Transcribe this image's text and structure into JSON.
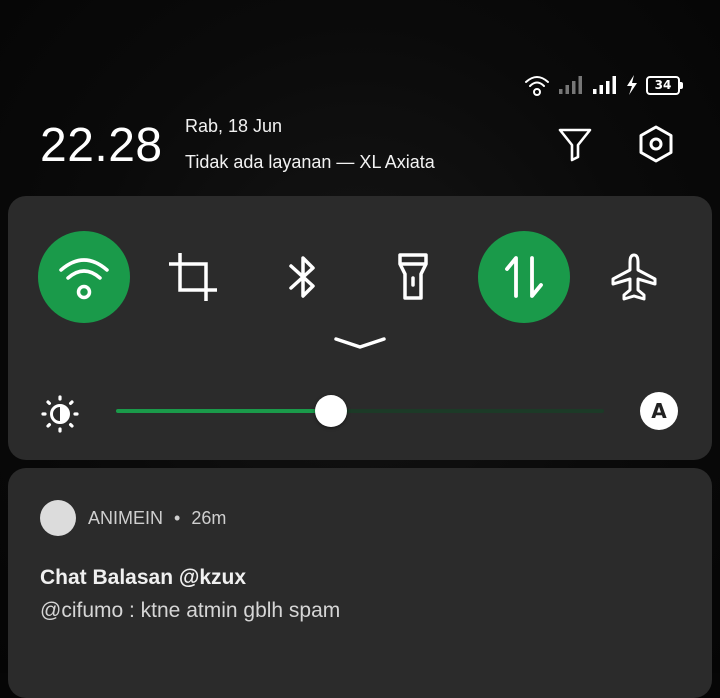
{
  "status_bar": {
    "battery_level": "34",
    "icons": [
      "wifi-icon",
      "signal-sim1-icon",
      "signal-sim2-icon",
      "charging-bolt-icon",
      "battery-icon"
    ]
  },
  "header": {
    "time": "22.28",
    "date": "Rab, 18 Jun",
    "carrier": "Tidak ada layanan — XL Axiata",
    "icons": [
      "filter-icon",
      "settings-icon"
    ]
  },
  "quick_tiles": [
    {
      "icon": "wifi-icon",
      "active": true
    },
    {
      "icon": "screenshot-crop-icon",
      "active": false
    },
    {
      "icon": "bluetooth-icon",
      "active": false
    },
    {
      "icon": "flashlight-icon",
      "active": false
    },
    {
      "icon": "mobile-data-icon",
      "active": true
    },
    {
      "icon": "airplane-icon",
      "active": false
    }
  ],
  "brightness": {
    "level": 0.44,
    "auto_label": "A"
  },
  "colors": {
    "accent": "#1a9a4a",
    "panel": "#2b2b2b",
    "background": "#0a0a0a"
  },
  "notification": {
    "app_name": "ANIMEIN",
    "separator": "•",
    "time_ago": "26m",
    "title": "Chat Balasan @kzux",
    "body": "@cifumo : ktne atmin gblh spam"
  }
}
